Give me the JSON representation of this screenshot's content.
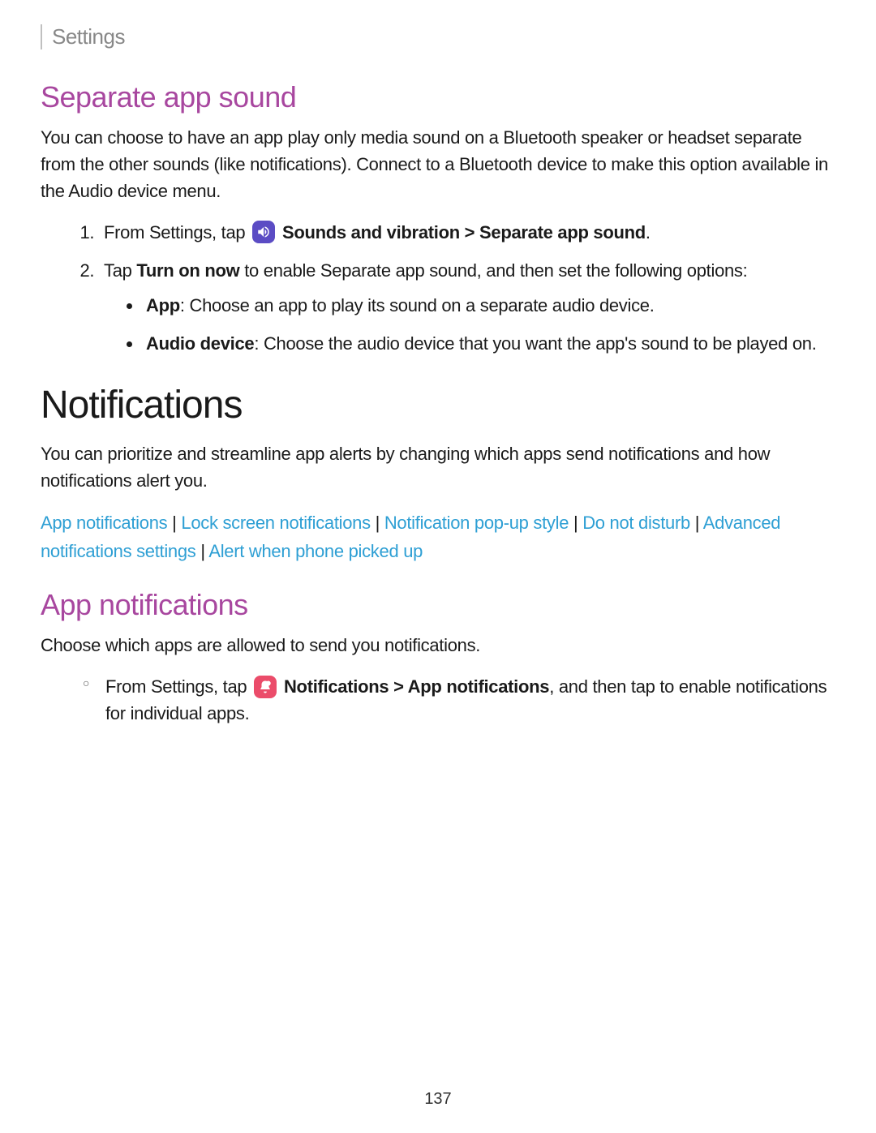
{
  "header": {
    "title": "Settings"
  },
  "section1": {
    "heading": "Separate app sound",
    "intro": "You can choose to have an app play only media sound on a Bluetooth speaker or headset separate from the other sounds (like notifications). Connect to a Bluetooth device to make this option available in the Audio device menu.",
    "steps": {
      "step1_prefix": "From Settings, tap ",
      "step1_bold": " Sounds and vibration > Separate app sound",
      "step1_suffix": ".",
      "step2_prefix": "Tap ",
      "step2_bold": "Turn on now",
      "step2_suffix": " to enable Separate app sound, and then set the following options:",
      "bullets": {
        "b1_bold": "App",
        "b1_text": ": Choose an app to play its sound on a separate audio device.",
        "b2_bold": "Audio device",
        "b2_text": ": Choose the audio device that you want the app's sound to be played on."
      }
    }
  },
  "section2": {
    "heading": "Notifications",
    "intro": "You can prioritize and streamline app alerts by changing which apps send notifications and how notifications alert you.",
    "links": {
      "l1": "App notifications",
      "l2": "Lock screen notifications",
      "l3": "Notification pop-up style",
      "l4": "Do not disturb",
      "l5": "Advanced notifications settings",
      "l6": "Alert when phone picked up",
      "sep": " | "
    }
  },
  "section3": {
    "heading": "App notifications",
    "intro": "Choose which apps are allowed to send you notifications.",
    "step": {
      "prefix": "From Settings, tap ",
      "bold1": " Notifications > App notifications",
      "suffix": ", and then tap to enable notifications for individual apps."
    }
  },
  "pageNumber": "137"
}
